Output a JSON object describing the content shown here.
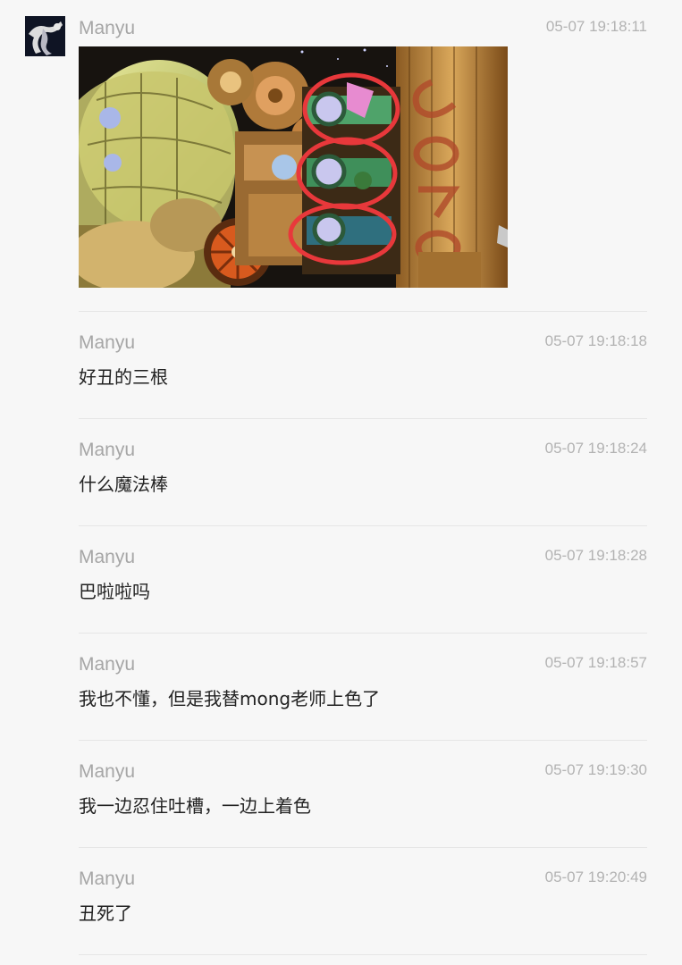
{
  "messages": [
    {
      "sender": "Manyu",
      "time": "05-07 19:18:11",
      "type": "image"
    },
    {
      "sender": "Manyu",
      "time": "05-07 19:18:18",
      "text": "好丑的三根"
    },
    {
      "sender": "Manyu",
      "time": "05-07 19:18:24",
      "text": "什么魔法棒"
    },
    {
      "sender": "Manyu",
      "time": "05-07 19:18:28",
      "text": "巴啦啦吗"
    },
    {
      "sender": "Manyu",
      "time": "05-07 19:18:57",
      "text": "我也不懂，但是我替mong老师上色了"
    },
    {
      "sender": "Manyu",
      "time": "05-07 19:19:30",
      "text": "我一边忍住吐槽，一边上着色"
    },
    {
      "sender": "Manyu",
      "time": "05-07 19:20:49",
      "text": "丑死了"
    }
  ],
  "colors": {
    "background": "#f7f7f7",
    "sender": "#a6a6a6",
    "time": "#b3b3b3",
    "text": "#222222",
    "divider": "#e6e6e6",
    "annotation_circle": "#e8383b"
  }
}
